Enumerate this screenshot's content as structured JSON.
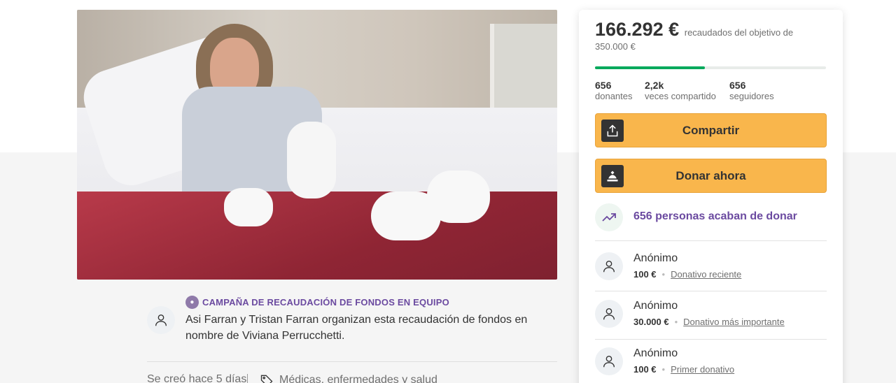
{
  "campaign": {
    "badge": "CAMPAÑA DE RECAUDACIÓN DE FONDOS EN EQUIPO",
    "organizer_text": "Asi Farran y Tristan Farran organizan esta recaudación de fondos en nombre de Viviana Perrucchetti.",
    "created": "Se creó hace 5 días",
    "category": "Médicas, enfermedades y salud"
  },
  "sidebar": {
    "raised_amount": "166.292 €",
    "raised_text": "recaudados del objetivo de 350.000 €",
    "progress_fraction": 0.475,
    "stats": [
      {
        "value": "656",
        "label": "donantes"
      },
      {
        "value": "2,2k",
        "label": "veces compartido"
      },
      {
        "value": "656",
        "label": "seguidores"
      }
    ],
    "share_label": "Compartir",
    "donate_label": "Donar ahora",
    "recent_text": "656 personas acaban de donar",
    "donations": [
      {
        "name": "Anónimo",
        "amount": "100 €",
        "tag": "Donativo reciente"
      },
      {
        "name": "Anónimo",
        "amount": "30.000 €",
        "tag": "Donativo más importante"
      },
      {
        "name": "Anónimo",
        "amount": "100 €",
        "tag": "Primer donativo"
      }
    ]
  },
  "colors": {
    "accent": "#f9b64c",
    "progress": "#02a95c",
    "purple": "#6b4aa0"
  }
}
